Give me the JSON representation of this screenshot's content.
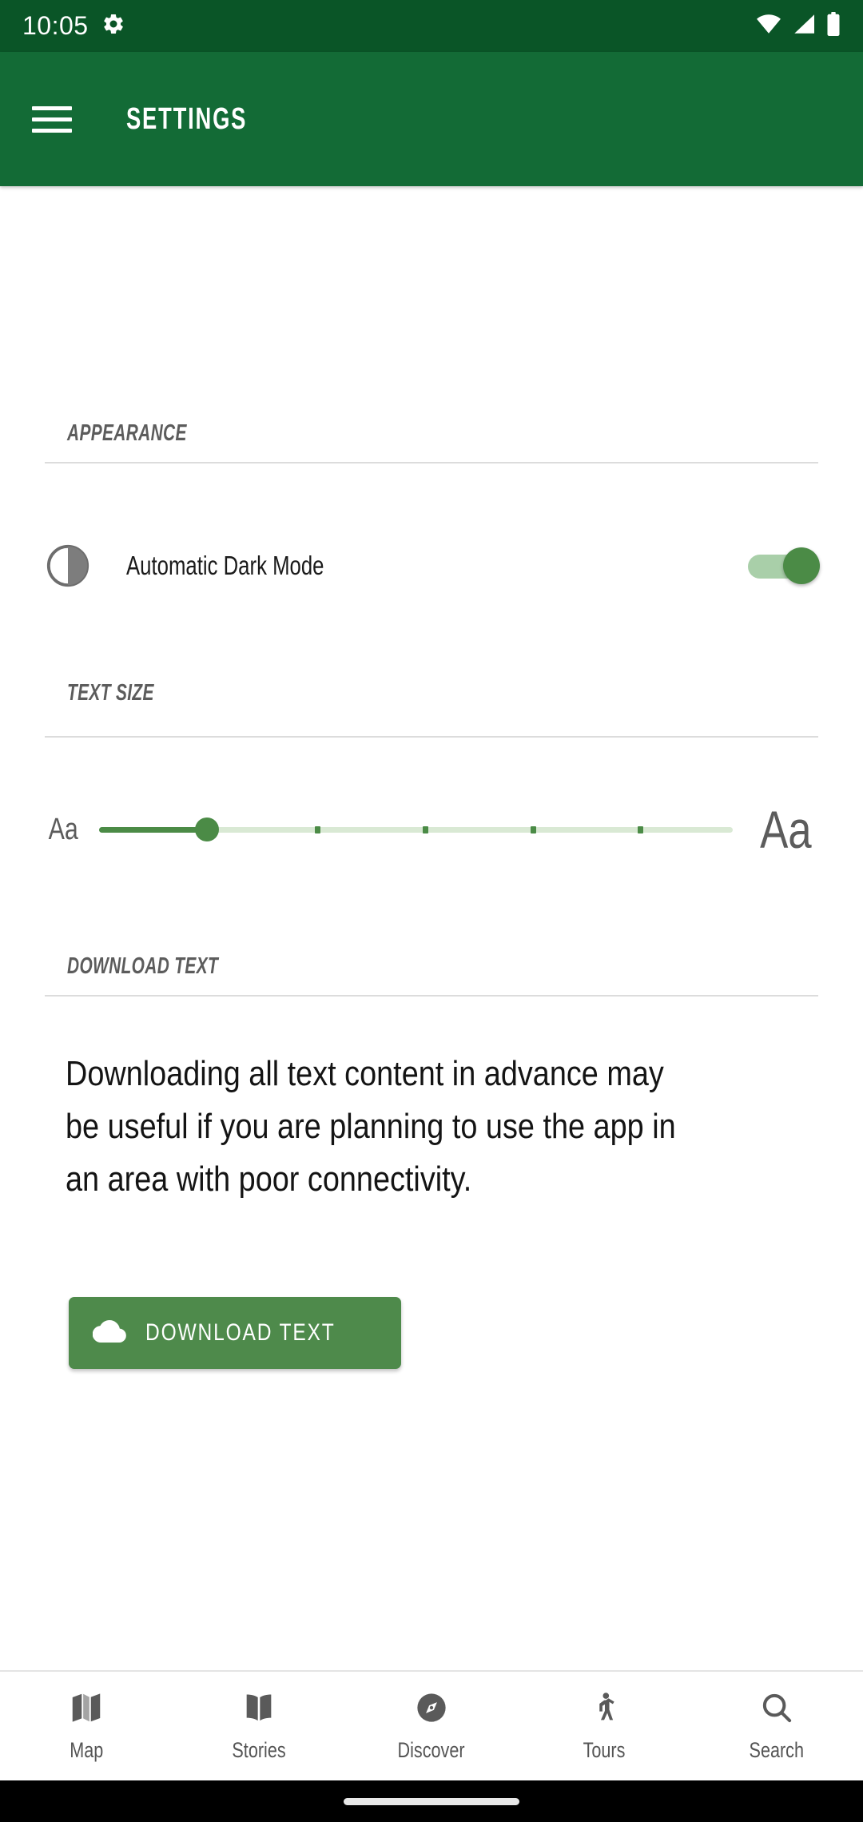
{
  "status_bar": {
    "time": "10:05",
    "icons": [
      "gear-icon",
      "wifi-icon",
      "cellular-signal-icon",
      "battery-icon"
    ],
    "background_color": "#0a5527"
  },
  "app_bar": {
    "title": "SETTINGS",
    "menu_icon": "hamburger-menu-icon",
    "background_color": "#136b36"
  },
  "sections": {
    "appearance": {
      "header": "APPEARANCE",
      "dark_mode_row": {
        "icon": "half-circle-contrast-icon",
        "label": "Automatic Dark Mode",
        "toggle_on": true,
        "toggle_track_color": "#a9cfa9",
        "toggle_thumb_color": "#4b8b46"
      }
    },
    "text_size": {
      "header": "TEXT SIZE",
      "small_label": "Aa",
      "large_label": "Aa",
      "slider": {
        "value_percent": 17,
        "tick_percents": [
          17,
          34,
          51,
          68,
          85
        ],
        "fill_color": "#4b8b46",
        "track_color": "#d9e9d4"
      }
    },
    "download_text": {
      "header": "DOWNLOAD TEXT",
      "description": "Downloading all text content in advance may be useful if you are planning to use the app in an area with poor connectivity.",
      "button": {
        "label": "DOWNLOAD TEXT",
        "icon": "cloud-download-icon",
        "background_color": "#4e8a4b"
      }
    }
  },
  "bottom_nav": {
    "items": [
      {
        "label": "Map",
        "icon": "map-icon"
      },
      {
        "label": "Stories",
        "icon": "open-book-icon"
      },
      {
        "label": "Discover",
        "icon": "compass-icon"
      },
      {
        "label": "Tours",
        "icon": "walking-person-icon"
      },
      {
        "label": "Search",
        "icon": "search-icon"
      }
    ]
  }
}
